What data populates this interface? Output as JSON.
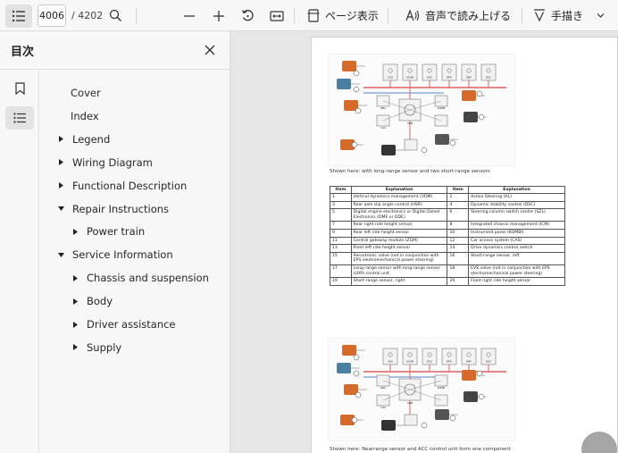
{
  "toolbar": {
    "page_current": "4006",
    "page_total": "/ 4202",
    "page_view_label": "ページ表示",
    "read_aloud_label": "音声で読み上げる",
    "draw_label": "手描き"
  },
  "sidebar": {
    "title": "目次",
    "toc": [
      {
        "label": "Cover",
        "level": 0,
        "expandable": false
      },
      {
        "label": "Index",
        "level": 0,
        "expandable": false
      },
      {
        "label": "Legend",
        "level": 0,
        "expandable": true,
        "expanded": false
      },
      {
        "label": "Wiring Diagram",
        "level": 0,
        "expandable": true,
        "expanded": false
      },
      {
        "label": "Functional Description",
        "level": 0,
        "expandable": true,
        "expanded": false
      },
      {
        "label": "Repair Instructions",
        "level": 0,
        "expandable": true,
        "expanded": true
      },
      {
        "label": "Power train",
        "level": 1,
        "expandable": true,
        "expanded": false
      },
      {
        "label": "Service Information",
        "level": 0,
        "expandable": true,
        "expanded": true
      },
      {
        "label": "Chassis and suspension",
        "level": 1,
        "expandable": true,
        "expanded": false
      },
      {
        "label": "Body",
        "level": 1,
        "expandable": true,
        "expanded": false
      },
      {
        "label": "Driver assistance",
        "level": 1,
        "expandable": true,
        "expanded": false
      },
      {
        "label": "Supply",
        "level": 1,
        "expandable": true,
        "expanded": false
      }
    ]
  },
  "document": {
    "diagram1_labels": [
      "ICM",
      "ACSM",
      "DSC",
      "EPS",
      "EMF",
      "ESC",
      "VDM",
      "EMA",
      "CAS",
      "KOMBI"
    ],
    "diagram2_labels": [
      "ICM",
      "ACSM",
      "DSC",
      "EPS",
      "EMF",
      "ESC",
      "VDM",
      "EMA",
      "CAS",
      "KOMBI"
    ],
    "caption1": "Shown here: with long-range sensor and two short-range sensors",
    "caption2": "Shown here: Nearrange sensor and ACC control unit form one component",
    "table_headers": [
      "Item",
      "Explanation",
      "Item",
      "Explanation"
    ],
    "table_rows": [
      [
        "1",
        "Vertical dynamics management (VDM)",
        "2",
        "Active Steering (AL)"
      ],
      [
        "3",
        "Rear axle slip angle control (HSR)",
        "4",
        "Dynamic stability control (DSC)"
      ],
      [
        "5",
        "Digital engine electronics or Digital Diesel Electronics (DME or DDE)",
        "6",
        "Steering column switch centre (SZL)"
      ],
      [
        "7",
        "Rear right ride height sensor",
        "8",
        "Integrated chassis management (ICM)"
      ],
      [
        "9",
        "Rear left ride height sensor",
        "10",
        "Instrument panel (KOMBI)"
      ],
      [
        "11",
        "Central gateway module (ZGM)",
        "12",
        "Car access system (CAS)"
      ],
      [
        "13",
        "Front left ride height sensor",
        "14",
        "Drive dynamics control switch"
      ],
      [
        "15",
        "Servotronic valve (not in conjunction with EPS electromechanical power steering)",
        "16",
        "Short-range sensor, left"
      ],
      [
        "17",
        "Long-range sensor with long-range sensor (LRR) control unit",
        "18",
        "EVS valve (not in conjunction with EPS electromechanical power steering)"
      ],
      [
        "19",
        "Short-range sensor, right",
        "20",
        "Front right ride height sensor"
      ]
    ]
  }
}
